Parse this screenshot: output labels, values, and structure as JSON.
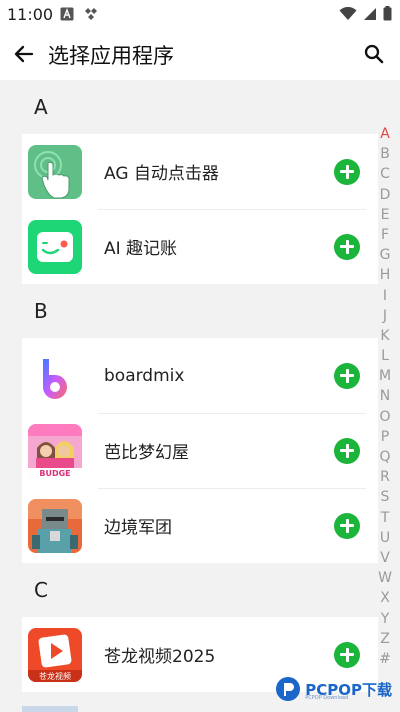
{
  "status": {
    "time": "11:00"
  },
  "appbar": {
    "title": "选择应用程序"
  },
  "sections": [
    {
      "letter": "A",
      "apps": [
        {
          "name": "AG 自动点击器"
        },
        {
          "name": "AI 趣记账"
        }
      ]
    },
    {
      "letter": "B",
      "apps": [
        {
          "name": "boardmix"
        },
        {
          "name": "芭比梦幻屋"
        },
        {
          "name": "边境军团"
        }
      ]
    },
    {
      "letter": "C",
      "apps": [
        {
          "name": "苍龙视频2025"
        }
      ]
    }
  ],
  "index_letters": [
    "A",
    "B",
    "C",
    "D",
    "E",
    "F",
    "G",
    "H",
    "I",
    "J",
    "K",
    "L",
    "M",
    "N",
    "O",
    "P",
    "Q",
    "R",
    "S",
    "T",
    "U",
    "V",
    "W",
    "X",
    "Y",
    "Z",
    "#"
  ],
  "index_active": "A",
  "icons": {
    "ag_label": "",
    "budge_label": "BUDGE",
    "canglong_label": "苍龙视频"
  },
  "watermark": {
    "text": "PCPOP下载",
    "sub": "PCPOP Download"
  },
  "colors": {
    "accent": "#1cb53b",
    "index_active": "#e04545"
  }
}
